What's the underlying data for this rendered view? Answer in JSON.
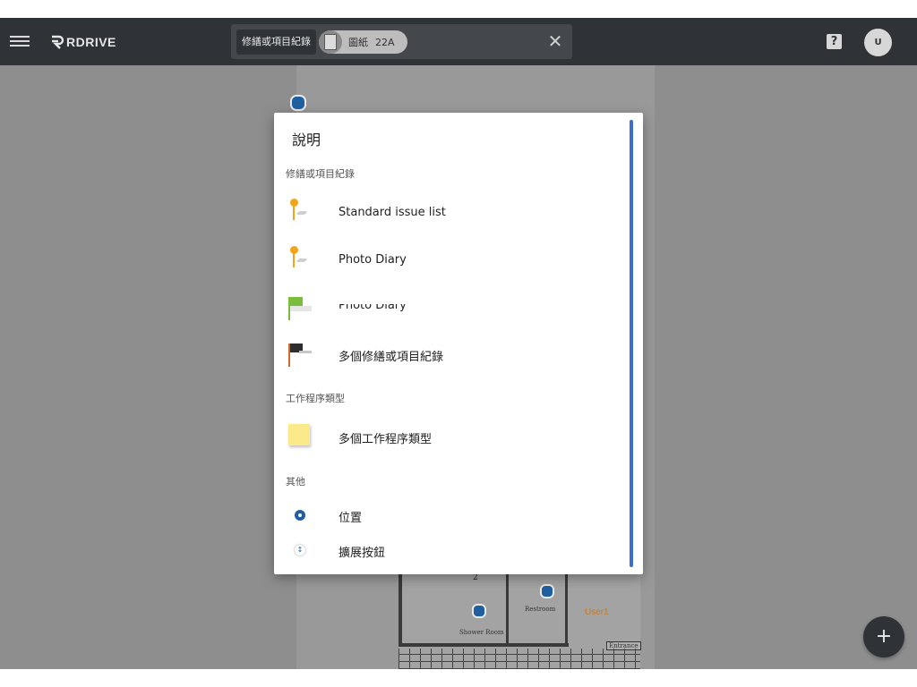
{
  "appbar": {
    "logo_text": "RDRIVE",
    "search": {
      "type_chip": "修繕或項目紀錄",
      "sheet_chip_label": "圖紙",
      "sheet_chip_code": "22A",
      "clear_icon": "close-icon"
    },
    "help_label": "?",
    "user_initial": "U"
  },
  "canvas": {
    "floorplan_room_number": "2",
    "floorplan_labels": [
      "Restroom",
      "Shower Room",
      "Entrance"
    ],
    "floorplan_user_tag": "User1",
    "fab_label": "+"
  },
  "dialog": {
    "title": "說明",
    "sections": [
      {
        "label": "修繕或項目紀錄",
        "items": [
          {
            "label": "Standard issue list",
            "icon": "orange-pin-icon"
          },
          {
            "label": "Photo Diary",
            "icon": "orange-pin-icon"
          },
          {
            "label": "Photo Diary",
            "icon": "green-flag-icon"
          },
          {
            "label": "多個修繕或項目紀錄",
            "icon": "black-flag-icon"
          }
        ]
      },
      {
        "label": "工作程序類型",
        "items": [
          {
            "label": "多個工作程序類型",
            "icon": "sticky-note-icon"
          }
        ]
      },
      {
        "label": "其他",
        "items": [
          {
            "label": "位置",
            "icon": "location-pin-icon"
          },
          {
            "label": "擴展按鈕",
            "icon": "expand-button-icon"
          }
        ]
      }
    ]
  },
  "colors": {
    "appbar": "#2f3236",
    "accent_scroll": "#3a6fd0",
    "pin_orange": "#f2a51a",
    "location_blue": "#1f5fa0",
    "flag_green": "#7bbd3c"
  }
}
